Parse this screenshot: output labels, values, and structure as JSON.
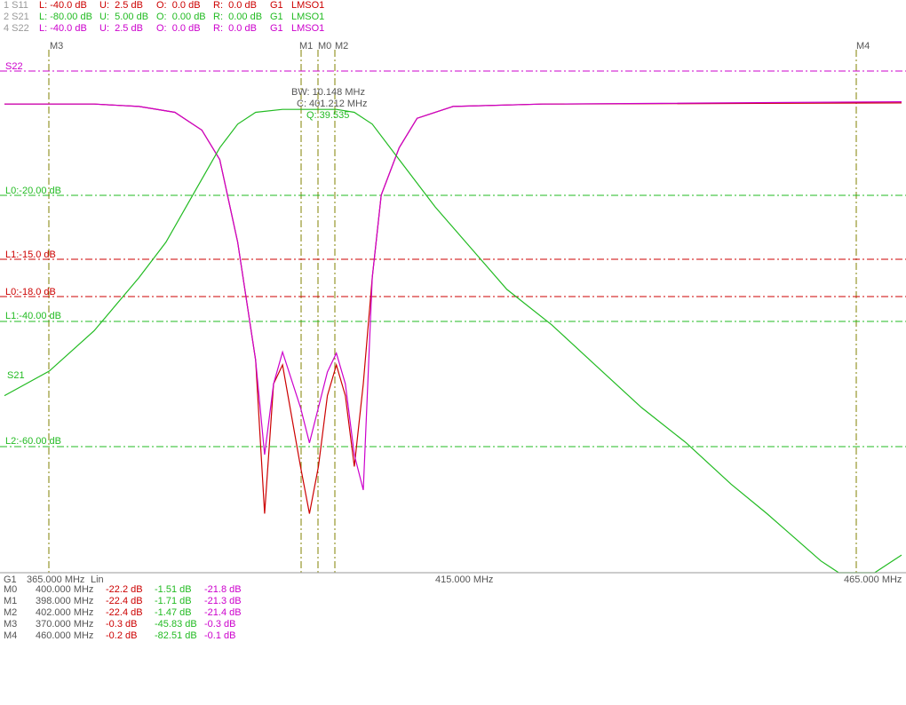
{
  "header": {
    "rows": [
      {
        "trace": "1 S11",
        "L": "L: -40.0 dB",
        "U": "U:  2.5 dB",
        "O": "O:  0.0 dB",
        "R": "R:  0.0 dB",
        "group": "G1",
        "mode": "LMSO1",
        "color": "#cc0000"
      },
      {
        "trace": "2 S21",
        "L": "L: -80.00 dB",
        "U": "U:  5.00 dB",
        "O": "O:  0.00 dB",
        "R": "R:  0.00 dB",
        "group": "G1",
        "mode": "LMSO1",
        "color": "#22bb22"
      },
      {
        "trace": "4 S22",
        "L": "L: -40.0 dB",
        "U": "U:  2.5 dB",
        "O": "O:  0.0 dB",
        "R": "R:  0.0 dB",
        "group": "G1",
        "mode": "LMSO1",
        "color": "#cc00cc"
      }
    ]
  },
  "markers": {
    "labels": [
      "M3",
      "M1",
      "M0",
      "M2",
      "M4"
    ]
  },
  "bandwidth_box": {
    "bw": "BW: 10.148 MHz",
    "center": "C: 401.212 MHz",
    "q": "Q: 39.535"
  },
  "limit_lines": [
    {
      "label": "L0:-20.00 dB",
      "color": "#22bb22"
    },
    {
      "label": "L1:-15.0 dB",
      "color": "#cc0000"
    },
    {
      "label": "L0:-18.0 dB",
      "color": "#cc0000"
    },
    {
      "label": "L1:-40.00 dB",
      "color": "#22bb22"
    },
    {
      "label": "L2:-60.00 dB",
      "color": "#22bb22"
    }
  ],
  "trace_labels": {
    "s21": "S21",
    "s22": "S22"
  },
  "axis": {
    "group": "G1",
    "start": "365.000 MHz",
    "scale": "Lin",
    "center": "415.000 MHz",
    "stop": "465.000 MHz"
  },
  "marker_table": [
    {
      "m": "M0",
      "freq": "400.000 MHz",
      "s11": "-22.2 dB",
      "s21": "-1.51 dB",
      "s22": "-21.8 dB"
    },
    {
      "m": "M1",
      "freq": "398.000 MHz",
      "s11": "-22.4 dB",
      "s21": "-1.71 dB",
      "s22": "-21.3 dB"
    },
    {
      "m": "M2",
      "freq": "402.000 MHz",
      "s11": "-22.4 dB",
      "s21": "-1.47 dB",
      "s22": "-21.4 dB"
    },
    {
      "m": "M3",
      "freq": "370.000 MHz",
      "s11": "-0.3 dB",
      "s21": "-45.83 dB",
      "s22": "-0.3 dB"
    },
    {
      "m": "M4",
      "freq": "460.000 MHz",
      "s11": "-0.2 dB",
      "s21": "-82.51 dB",
      "s22": "-0.1 dB"
    }
  ],
  "colors": {
    "s11": "#cc0000",
    "s21": "#22bb22",
    "s22": "#cc00cc",
    "marker_line": "#808000",
    "text": "#333333"
  },
  "chart_data": {
    "type": "line",
    "x_range_mhz": [
      365,
      465
    ],
    "series": [
      {
        "name": "S11",
        "ylim": [
          -40,
          2.5
        ],
        "points": [
          [
            365,
            -0.3
          ],
          [
            375,
            -0.3
          ],
          [
            380,
            -0.5
          ],
          [
            384,
            -1
          ],
          [
            387,
            -2.5
          ],
          [
            389,
            -5
          ],
          [
            391,
            -12
          ],
          [
            393,
            -22
          ],
          [
            394,
            -35
          ],
          [
            395,
            -24
          ],
          [
            396,
            -22.4
          ],
          [
            398,
            -31
          ],
          [
            399,
            -35
          ],
          [
            400,
            -31
          ],
          [
            401,
            -25
          ],
          [
            402,
            -22.4
          ],
          [
            403,
            -25
          ],
          [
            404,
            -31
          ],
          [
            405,
            -24
          ],
          [
            406,
            -15
          ],
          [
            407,
            -8
          ],
          [
            409,
            -4
          ],
          [
            411,
            -1.5
          ],
          [
            415,
            -0.5
          ],
          [
            425,
            -0.3
          ],
          [
            465,
            -0.2
          ]
        ]
      },
      {
        "name": "S22",
        "ylim": [
          -40,
          2.5
        ],
        "points": [
          [
            365,
            -0.3
          ],
          [
            375,
            -0.3
          ],
          [
            380,
            -0.5
          ],
          [
            384,
            -1
          ],
          [
            387,
            -2.5
          ],
          [
            389,
            -5
          ],
          [
            391,
            -12
          ],
          [
            393,
            -22
          ],
          [
            394,
            -30
          ],
          [
            395,
            -24
          ],
          [
            396,
            -21.3
          ],
          [
            398,
            -26
          ],
          [
            399,
            -29
          ],
          [
            400,
            -26
          ],
          [
            401,
            -23
          ],
          [
            402,
            -21.4
          ],
          [
            403,
            -24
          ],
          [
            404,
            -30
          ],
          [
            405,
            -33
          ],
          [
            406,
            -15
          ],
          [
            407,
            -8
          ],
          [
            409,
            -4
          ],
          [
            411,
            -1.5
          ],
          [
            415,
            -0.5
          ],
          [
            425,
            -0.3
          ],
          [
            465,
            -0.1
          ]
        ]
      },
      {
        "name": "S21",
        "ylim": [
          -80,
          5
        ],
        "points": [
          [
            365,
            -50
          ],
          [
            370,
            -45.83
          ],
          [
            375,
            -39
          ],
          [
            380,
            -30
          ],
          [
            383,
            -24
          ],
          [
            386,
            -16
          ],
          [
            389,
            -8
          ],
          [
            391,
            -4
          ],
          [
            393,
            -2
          ],
          [
            396,
            -1.5
          ],
          [
            400,
            -1.5
          ],
          [
            402,
            -1.5
          ],
          [
            404,
            -2
          ],
          [
            406,
            -4
          ],
          [
            409,
            -10
          ],
          [
            413,
            -18
          ],
          [
            417,
            -25
          ],
          [
            421,
            -32
          ],
          [
            426,
            -38
          ],
          [
            431,
            -45
          ],
          [
            436,
            -52
          ],
          [
            441,
            -58
          ],
          [
            446,
            -65
          ],
          [
            450,
            -70
          ],
          [
            453,
            -74
          ],
          [
            456,
            -78
          ],
          [
            458,
            -82
          ],
          [
            460,
            -82.51
          ],
          [
            462,
            -80
          ],
          [
            465,
            -77
          ]
        ]
      }
    ]
  }
}
